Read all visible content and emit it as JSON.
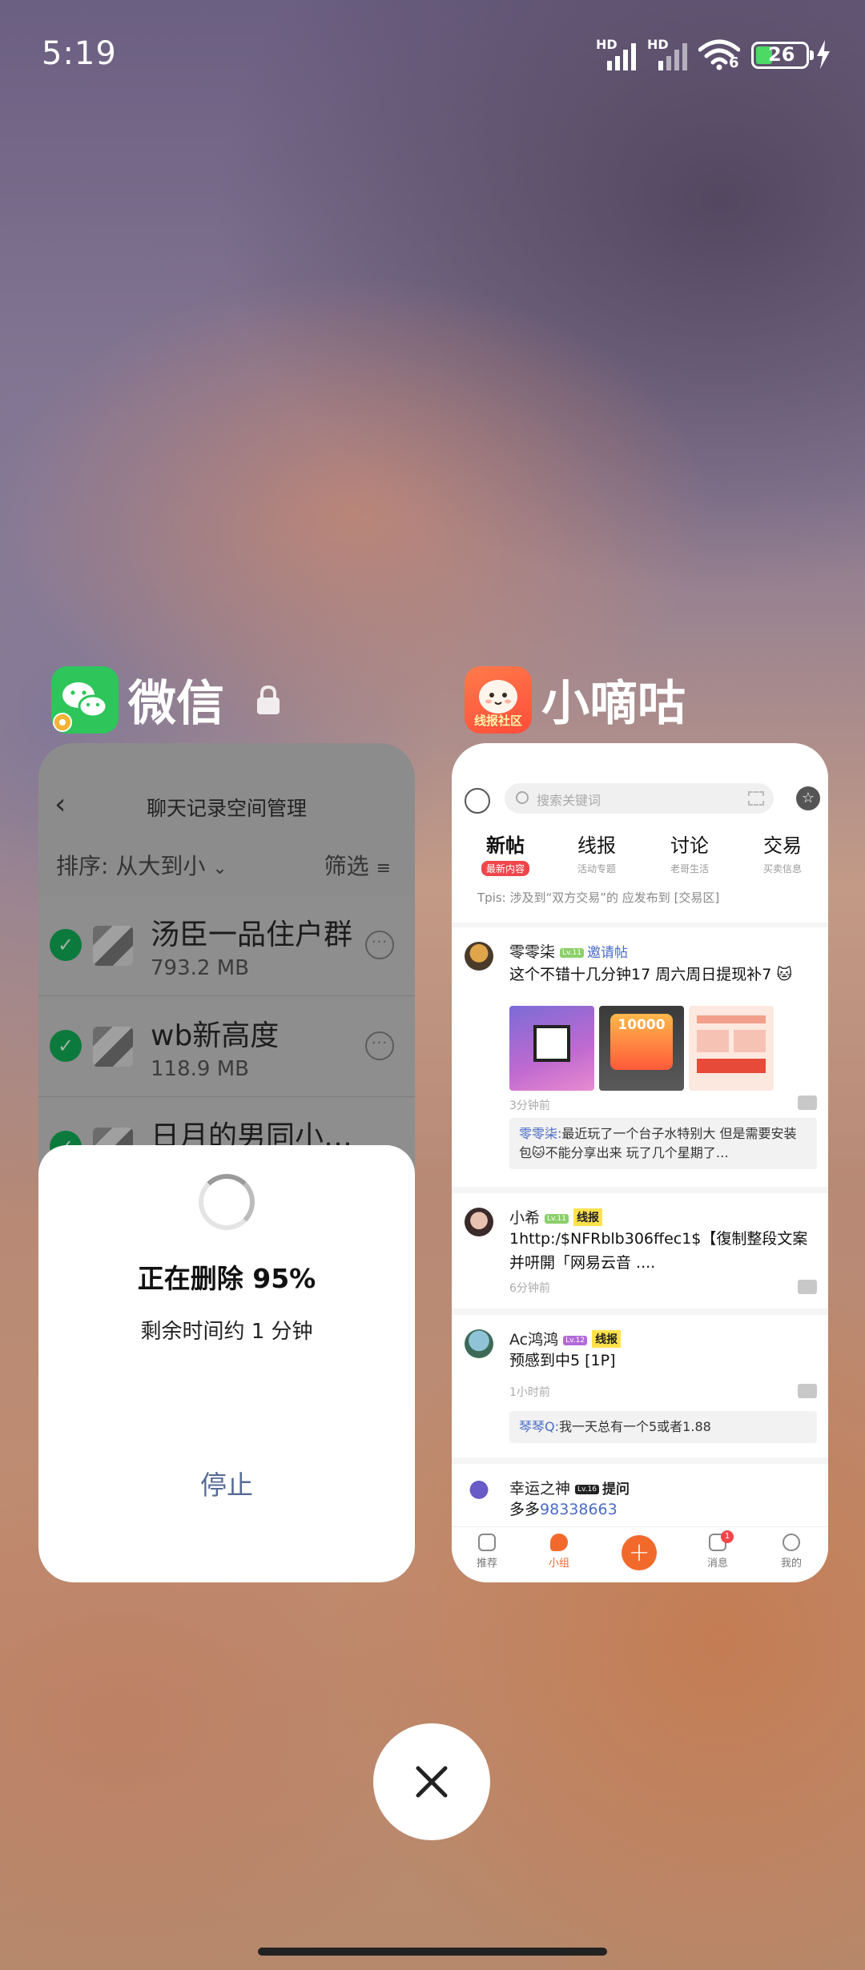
{
  "status_bar": {
    "time": "5:19",
    "sim1": "HD",
    "sim2": "HD",
    "wifi_label": "6",
    "battery": "26",
    "battery_color": "#4cd964"
  },
  "recents": [
    {
      "app_name": "微信",
      "locked": true,
      "icon": "wechat-icon",
      "screen": {
        "title": "聊天记录空间管理",
        "sort_label": "排序: 从大到小",
        "filter_label": "筛选",
        "rows": [
          {
            "name": "汤臣一品住户群",
            "size": "793.2 MB"
          },
          {
            "name": "wb新高度",
            "size": "118.9 MB"
          },
          {
            "name": "日月的男同小…",
            "size": ""
          }
        ],
        "dialog": {
          "progress_text": "正在删除 95%",
          "progress": 0.95,
          "remaining": "剩余时间约 1 分钟",
          "stop": "停止"
        }
      }
    },
    {
      "app_name": "小嘀咕",
      "locked": false,
      "icon": "xiaodigu-icon",
      "icon_text": "线报社区",
      "screen": {
        "search_placeholder": "搜索关键词",
        "tabs": [
          {
            "label": "新帖",
            "sub": "最新内容",
            "active": true
          },
          {
            "label": "线报",
            "sub": "活动专题",
            "active": false
          },
          {
            "label": "讨论",
            "sub": "老哥生活",
            "active": false
          },
          {
            "label": "交易",
            "sub": "买卖信息",
            "active": false
          }
        ],
        "tip": "Tpis: 涉及到“双方交易”的 应发布到 [交易区]",
        "posts": [
          {
            "user": "零零柒",
            "level": "Lv.11",
            "tag": "邀请帖",
            "body": "这个不错十几分钟17 周六周日提现补7 🐱",
            "image_text": "10000",
            "time": "3分钟前",
            "reply_user": "零零柒:",
            "reply": "最近玩了一个台子水特别大 但是需要安装包🐱不能分享出来 玩了几个星期了…"
          },
          {
            "user": "小希",
            "level": "Lv.11",
            "tag": "线报",
            "body": "1http:/$NFRblb306ffec1$【復制整段文案并咞開「网易云音 ....",
            "time": "6分钟前"
          },
          {
            "user": "Ac鸿鸿",
            "level": "Lv.12",
            "tag": "线报",
            "body": "预感到中5 [1P]",
            "time": "1小时前",
            "reply_user": "琴琴Q:",
            "reply": "我一天总有一个5或者1.88"
          },
          {
            "user": "幸运之神",
            "level": "Lv.16",
            "tag": "提问",
            "body_prefix": "多多",
            "body_link": "98338663"
          }
        ],
        "nav": [
          {
            "label": "推荐"
          },
          {
            "label": "小组",
            "active": true
          },
          {
            "label": "消息",
            "badge": "1"
          },
          {
            "label": "我的"
          }
        ]
      }
    }
  ]
}
